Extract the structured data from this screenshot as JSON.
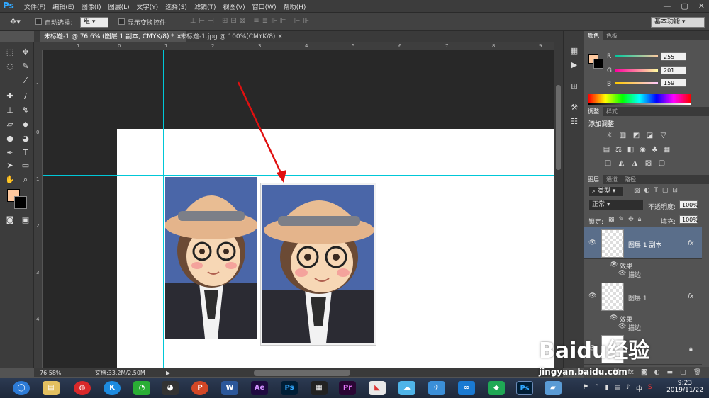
{
  "app": {
    "logo": "Ps"
  },
  "menu": [
    "文件(F)",
    "编辑(E)",
    "图像(I)",
    "图层(L)",
    "文字(Y)",
    "选择(S)",
    "滤镜(T)",
    "视图(V)",
    "窗口(W)",
    "帮助(H)"
  ],
  "window_controls": {
    "minimize": "—",
    "restore": "▢",
    "close": "✕"
  },
  "options": {
    "auto_select_label": "自动选择：",
    "auto_select_value": "组",
    "show_transform_label": "显示变换控件",
    "workspace": "基本功能"
  },
  "tabs": [
    {
      "label": "未标题-1 @ 76.6% (图层 1 副本, CMYK/8) *",
      "close": "×"
    },
    {
      "label": "未标题-1.jpg @ 100%(CMYK/8)",
      "close": "×"
    }
  ],
  "ruler": {
    "h": [
      "1",
      "0",
      "1",
      "2",
      "3",
      "4",
      "5",
      "6",
      "7",
      "8",
      "9"
    ],
    "v": [
      "1",
      "0",
      "1",
      "2",
      "3",
      "4"
    ]
  },
  "status": {
    "zoom": "76.58%",
    "doc": "文档:33.2M/2.50M"
  },
  "color_panel": {
    "tabs": [
      "颜色",
      "色板"
    ],
    "r_label": "R",
    "r_value": "255",
    "g_label": "G",
    "g_value": "201",
    "b_label": "B",
    "b_value": "159",
    "foreground": "#ffc99f"
  },
  "adjust_panel": {
    "tabs": [
      "调整",
      "样式"
    ],
    "title": "添加调整"
  },
  "layers_panel": {
    "tabs": [
      "图层",
      "通道",
      "路径"
    ],
    "kind": "类型",
    "blend": "正常",
    "opacity_label": "不透明度:",
    "opacity": "100%",
    "lock_label": "锁定:",
    "fill_label": "填充:",
    "fill": "100%",
    "layers": [
      {
        "name": "图层 1 副本",
        "fx": "fx",
        "effects": "效果",
        "stroke": "描边"
      },
      {
        "name": "图层 1",
        "fx": "fx",
        "effects": "效果",
        "stroke": "描边"
      }
    ]
  },
  "taskbar": {
    "apps": [
      "Ae",
      "Ps",
      "Pr",
      "W",
      "P",
      "K"
    ],
    "tray_lang": "中",
    "time": "9:23",
    "date": "2019/11/22"
  },
  "watermark": {
    "text": "Baidu经验",
    "url": "jingyan.baidu.com"
  }
}
